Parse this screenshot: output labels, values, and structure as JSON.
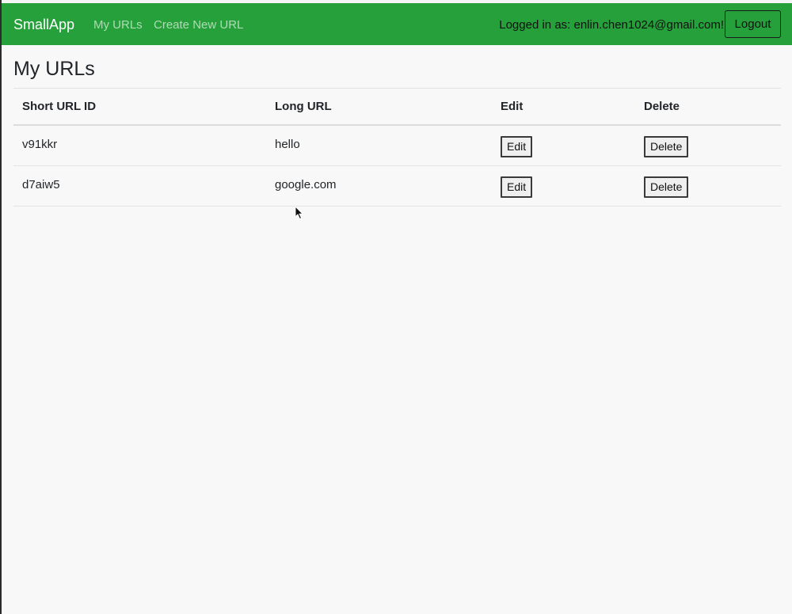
{
  "navbar": {
    "brand": "SmallApp",
    "links": [
      "My URLs",
      "Create New URL"
    ],
    "logged_in_text": "Logged in as: enlin.chen1024@gmail.com!",
    "logout_label": "Logout",
    "color": "#25a03a"
  },
  "page": {
    "title": "My URLs"
  },
  "table": {
    "headers": [
      "Short URL ID",
      "Long URL",
      "Edit",
      "Delete"
    ],
    "rows": [
      {
        "short_id": "v91kkr",
        "long_url": "hello",
        "edit_label": "Edit",
        "delete_label": "Delete"
      },
      {
        "short_id": "d7aiw5",
        "long_url": "google.com",
        "edit_label": "Edit",
        "delete_label": "Delete"
      }
    ]
  },
  "icons": {
    "cursor": "mouse-pointer-icon"
  }
}
